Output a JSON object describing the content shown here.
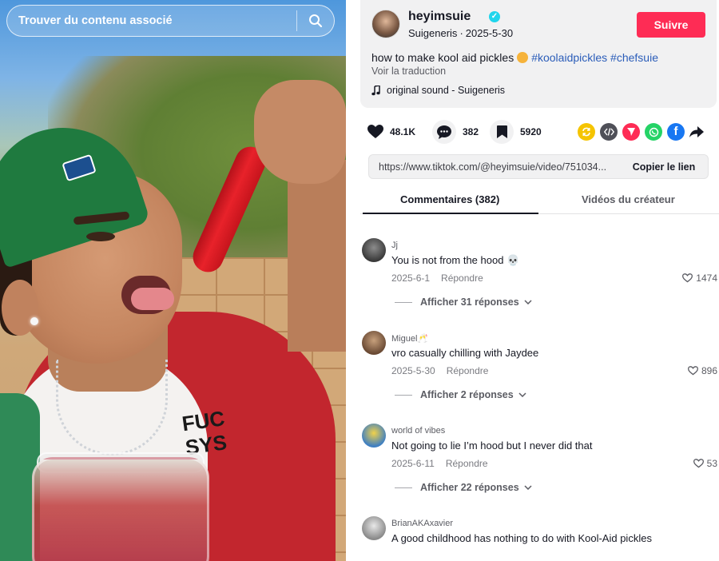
{
  "search": {
    "placeholder": "Trouver du contenu associé"
  },
  "creator": {
    "username": "heyimsuie",
    "nickname": "Suigeneris",
    "date": "2025-5-30",
    "follow_label": "Suivre"
  },
  "video": {
    "caption": "how to make kool aid pickles",
    "hashtags": [
      "#koolaidpickles",
      "#chefsuie"
    ],
    "translate_label": "Voir la traduction",
    "sound": "original sound - Suigeneris",
    "shirt_print": "FUC\nSYS"
  },
  "actions": {
    "likes": "48.1K",
    "comments": "382",
    "saves": "5920"
  },
  "link": {
    "url": "https://www.tiktok.com/@heyimsuie/video/751034...",
    "copy_label": "Copier le lien"
  },
  "tabs": {
    "comments_tab": "Commentaires (382)",
    "creator_videos_tab": "Vidéos du créateur"
  },
  "comments": [
    {
      "user": "Jj",
      "text": "You is not from the hood 💀",
      "date": "2025-6-1",
      "reply_label": "Répondre",
      "likes": "1474",
      "replies_label": "Afficher 31 réponses"
    },
    {
      "user": "Miguel🥂",
      "text": "vro casually chilling with Jaydee",
      "date": "2025-5-30",
      "reply_label": "Répondre",
      "likes": "896",
      "replies_label": "Afficher 2 réponses"
    },
    {
      "user": "world of vibes",
      "text": "Not going to lie I’m hood but I never did that",
      "date": "2025-6-11",
      "reply_label": "Répondre",
      "likes": "53",
      "replies_label": "Afficher 22 réponses"
    },
    {
      "user": "BrianAKAxavier",
      "text": "A good childhood has nothing to do with Kool-Aid pickles"
    }
  ],
  "colors": {
    "accent": "#fe2c55",
    "hashtag": "#2b5db9",
    "verified": "#20d5ec"
  }
}
